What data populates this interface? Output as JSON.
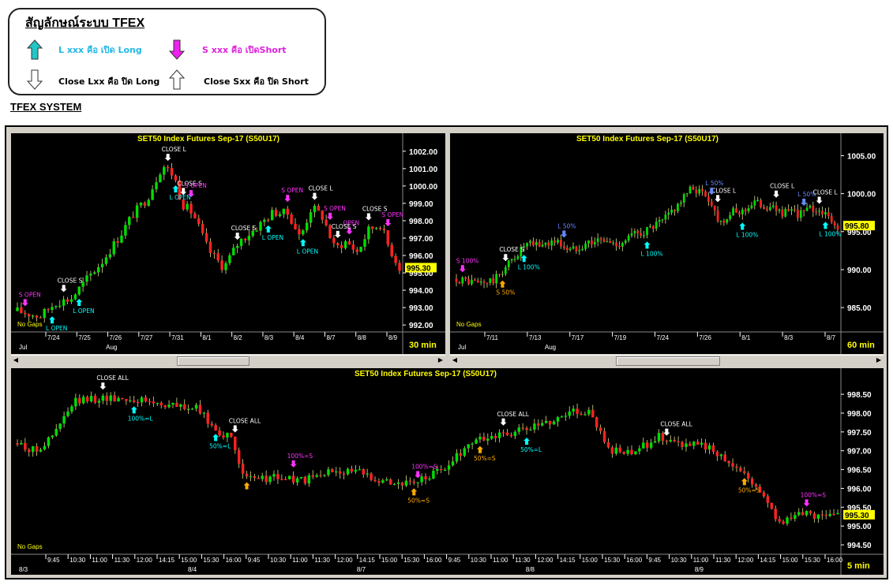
{
  "legend": {
    "title": "สัญลักษณ์ระบบ TFEX",
    "long_open": "L xxx คือ เปิด Long",
    "short_open": "S xxx คือ เปิดShort",
    "close_long": "Close Lxx คือ ปิด Long",
    "close_short": "Close Sxx คือ ปิด Short"
  },
  "system_title": "TFEX SYSTEM",
  "colors": {
    "up": "#00dd00",
    "down": "#ff2222",
    "cyan": "#00ffff",
    "magenta": "#ff33ff",
    "white": "#ffffff",
    "orange": "#ffaa00",
    "blue": "#6688ff",
    "yellow": "#ffff00"
  },
  "panels": [
    {
      "id": "p30",
      "title": "SET50  Index  Futures  Sep-17  (S50U17)",
      "timeframe": "30  min",
      "no_gaps": "No  Gaps",
      "last_price": "995.30",
      "ymin": 991.6,
      "ymax": 1002.4,
      "yticks": [
        "1002.00",
        "1001.00",
        "1000.00",
        "999.00",
        "998.00",
        "997.00",
        "996.00",
        "995.00",
        "994.00",
        "993.00",
        "992.00"
      ],
      "xticks": [
        "7/24",
        "7/25",
        "7/26",
        "7/27",
        "7/31",
        "8/1",
        "8/2",
        "8/3",
        "8/4",
        "8/7",
        "8/8",
        "8/9"
      ],
      "months": [
        "Jul",
        "Aug"
      ],
      "path": [
        [
          0,
          992.8
        ],
        [
          6,
          992.5
        ],
        [
          10,
          993.3
        ],
        [
          14,
          993.5
        ],
        [
          18,
          994.6
        ],
        [
          22,
          995.6
        ],
        [
          27,
          997.2
        ],
        [
          30,
          998.3
        ],
        [
          34,
          999.3
        ],
        [
          38,
          1001.2
        ],
        [
          41,
          1000.6
        ],
        [
          43,
          999.0
        ],
        [
          46,
          998.4
        ],
        [
          50,
          996.3
        ],
        [
          54,
          995.3
        ],
        [
          58,
          996.8
        ],
        [
          62,
          997.5
        ],
        [
          67,
          998.5
        ],
        [
          71,
          998.4
        ],
        [
          74,
          997.0
        ],
        [
          77,
          998.8
        ],
        [
          80,
          998.2
        ],
        [
          83,
          996.4
        ],
        [
          86,
          996.8
        ],
        [
          89,
          996.2
        ],
        [
          92,
          997.5
        ],
        [
          95,
          997.8
        ],
        [
          97,
          996.6
        ],
        [
          100,
          995.3
        ]
      ],
      "signals": [
        {
          "type": "short",
          "text": "S  OPEN",
          "i": 2
        },
        {
          "type": "long",
          "text": "L  OPEN",
          "i": 9
        },
        {
          "type": "close",
          "text": "CLOSE S",
          "i": 12
        },
        {
          "type": "long",
          "text": "L  OPEN",
          "i": 16
        },
        {
          "type": "close",
          "text": "CLOSE L",
          "i": 39
        },
        {
          "type": "close",
          "text": "CLOSE S",
          "i": 43
        },
        {
          "type": "short",
          "text": "S  OPEN",
          "i": 45
        },
        {
          "type": "long",
          "text": "L  OPEN",
          "i": 41
        },
        {
          "type": "close",
          "text": "CLOSE S",
          "i": 58
        },
        {
          "type": "long",
          "text": "L  OPEN",
          "i": 66
        },
        {
          "type": "short",
          "text": "S  OPEN",
          "i": 71
        },
        {
          "type": "long",
          "text": "L  OPEN",
          "i": 75
        },
        {
          "type": "close",
          "text": "CLOSE L",
          "i": 78
        },
        {
          "type": "short",
          "text": "S  OPEN",
          "i": 82
        },
        {
          "type": "short",
          "text": "OPEN",
          "i": 87
        },
        {
          "type": "close",
          "text": "CLOSE S",
          "i": 84
        },
        {
          "type": "close",
          "text": "CLOSE S",
          "i": 92
        },
        {
          "type": "short",
          "text": "S  OPEN",
          "i": 97
        }
      ]
    },
    {
      "id": "p60",
      "title": "SET50  Index  Futures  Sep-17  (S50U17)",
      "timeframe": "60  min",
      "no_gaps": "No  Gaps",
      "last_price": "995.80",
      "ymin": 981.8,
      "ymax": 1006.5,
      "yticks": [
        "1005.00",
        "1000.00",
        "995.00",
        "990.00",
        "985.00"
      ],
      "xticks": [
        "7/11",
        "7/13",
        "7/17",
        "7/19",
        "7/24",
        "7/26",
        "8/1",
        "8/3",
        "8/7"
      ],
      "months": [
        "Jul",
        "Aug"
      ],
      "path": [
        [
          0,
          988.8
        ],
        [
          6,
          988.2
        ],
        [
          10,
          988.6
        ],
        [
          14,
          991.0
        ],
        [
          18,
          993.2
        ],
        [
          22,
          993.3
        ],
        [
          26,
          993.8
        ],
        [
          30,
          992.5
        ],
        [
          34,
          993.6
        ],
        [
          38,
          993.9
        ],
        [
          42,
          993.3
        ],
        [
          46,
          994.5
        ],
        [
          50,
          995.2
        ],
        [
          54,
          996.3
        ],
        [
          58,
          998.6
        ],
        [
          62,
          1000.8
        ],
        [
          66,
          999.6
        ],
        [
          69,
          996.3
        ],
        [
          72,
          997.4
        ],
        [
          75,
          997.7
        ],
        [
          78,
          998.9
        ],
        [
          82,
          998.2
        ],
        [
          86,
          997.5
        ],
        [
          90,
          997.4
        ],
        [
          93,
          998.0
        ],
        [
          96,
          997.7
        ],
        [
          99,
          995.8
        ]
      ],
      "signals": [
        {
          "type": "short",
          "text": "S  100%",
          "i": 2
        },
        {
          "type": "close",
          "text": "CLOSE S",
          "i": 16
        },
        {
          "type": "orange",
          "text": "S  50%",
          "i": 15
        },
        {
          "type": "long",
          "text": "L  100%",
          "i": 22
        },
        {
          "type": "blue",
          "text": "L  50%",
          "i": 35
        },
        {
          "type": "long",
          "text": "L  100%",
          "i": 63
        },
        {
          "type": "close",
          "text": "CLOSE L",
          "i": 86
        },
        {
          "type": "blue",
          "text": "L  50%",
          "i": 84
        },
        {
          "type": "long",
          "text": "L  100%",
          "i": 94
        },
        {
          "type": "close",
          "text": "CLOSE L",
          "i": 105
        },
        {
          "type": "blue",
          "text": "L  50%",
          "i": 114
        },
        {
          "type": "close",
          "text": "CLOSE L",
          "i": 119
        },
        {
          "type": "long",
          "text": "L  100%",
          "i": 121
        }
      ]
    },
    {
      "id": "p5",
      "title": "SET50  Index  Futures  Sep-17  (S50U17)",
      "timeframe": "5  min",
      "no_gaps": "No  Gaps",
      "last_price": "995.30",
      "ymin": 994.25,
      "ymax": 998.9,
      "yticks": [
        "998.50",
        "998.00",
        "997.50",
        "997.00",
        "996.50",
        "996.00",
        "995.50",
        "995.00",
        "994.50"
      ],
      "xticks": [
        "9:45",
        "10:30",
        "11:00",
        "11:30",
        "12:00",
        "14:15",
        "15:00",
        "15:30",
        "16:00",
        "9:45",
        "10:30",
        "11:00",
        "11:30",
        "12:00",
        "14:15",
        "15:00",
        "15:30",
        "16:00",
        "9:45",
        "10:30",
        "11:00",
        "11:30",
        "12:00",
        "14:15",
        "15:00",
        "15:30",
        "16:00",
        "9:45",
        "10:30",
        "11:00",
        "11:30",
        "12:00",
        "14:15",
        "15:00",
        "15:30",
        "16:00"
      ],
      "months": [
        "8/3",
        "8/4",
        "8/7",
        "8/8",
        "8/9"
      ],
      "path": [
        [
          0,
          997.2
        ],
        [
          2,
          997.0
        ],
        [
          4,
          997.3
        ],
        [
          7,
          998.3
        ],
        [
          10,
          998.4
        ],
        [
          13,
          998.4
        ],
        [
          16,
          998.3
        ],
        [
          19,
          998.2
        ],
        [
          22,
          998.1
        ],
        [
          24,
          997.6
        ],
        [
          26,
          997.3
        ],
        [
          28,
          996.2
        ],
        [
          31,
          996.3
        ],
        [
          35,
          996.2
        ],
        [
          39,
          996.5
        ],
        [
          42,
          996.4
        ],
        [
          45,
          996.2
        ],
        [
          48,
          996.1
        ],
        [
          51,
          996.4
        ],
        [
          53,
          996.7
        ],
        [
          55,
          997.2
        ],
        [
          58,
          997.4
        ],
        [
          61,
          997.5
        ],
        [
          64,
          997.7
        ],
        [
          68,
          998.1
        ],
        [
          70,
          998.0
        ],
        [
          72,
          997.0
        ],
        [
          75,
          996.9
        ],
        [
          78,
          997.4
        ],
        [
          81,
          997.2
        ],
        [
          84,
          997.1
        ],
        [
          87,
          996.7
        ],
        [
          90,
          996.1
        ],
        [
          93,
          995.1
        ],
        [
          95,
          995.3
        ]
      ],
      "signals": [
        {
          "type": "close",
          "text": "CLOSE  ALL",
          "i": 22
        },
        {
          "type": "long",
          "text": "100%=L",
          "i": 30
        },
        {
          "type": "long",
          "text": "50%=L",
          "i": 51
        },
        {
          "type": "orange",
          "text": "",
          "i": 59
        },
        {
          "type": "close",
          "text": "CLOSE  ALL",
          "i": 56
        },
        {
          "type": "short",
          "text": "100%=S",
          "i": 71
        },
        {
          "type": "short",
          "text": "100%=S",
          "i": 103
        },
        {
          "type": "orange",
          "text": "50%=S",
          "i": 102
        },
        {
          "type": "orange",
          "text": "50%=S",
          "i": 120
        },
        {
          "type": "close",
          "text": "CLOSE  ALL",
          "i": 126
        },
        {
          "type": "long",
          "text": "50%=L",
          "i": 132
        },
        {
          "type": "close",
          "text": "CLOSE  ALL",
          "i": 168
        },
        {
          "type": "orange",
          "text": "50%=S",
          "i": 188
        },
        {
          "type": "short",
          "text": "100%=S",
          "i": 204
        }
      ]
    }
  ]
}
